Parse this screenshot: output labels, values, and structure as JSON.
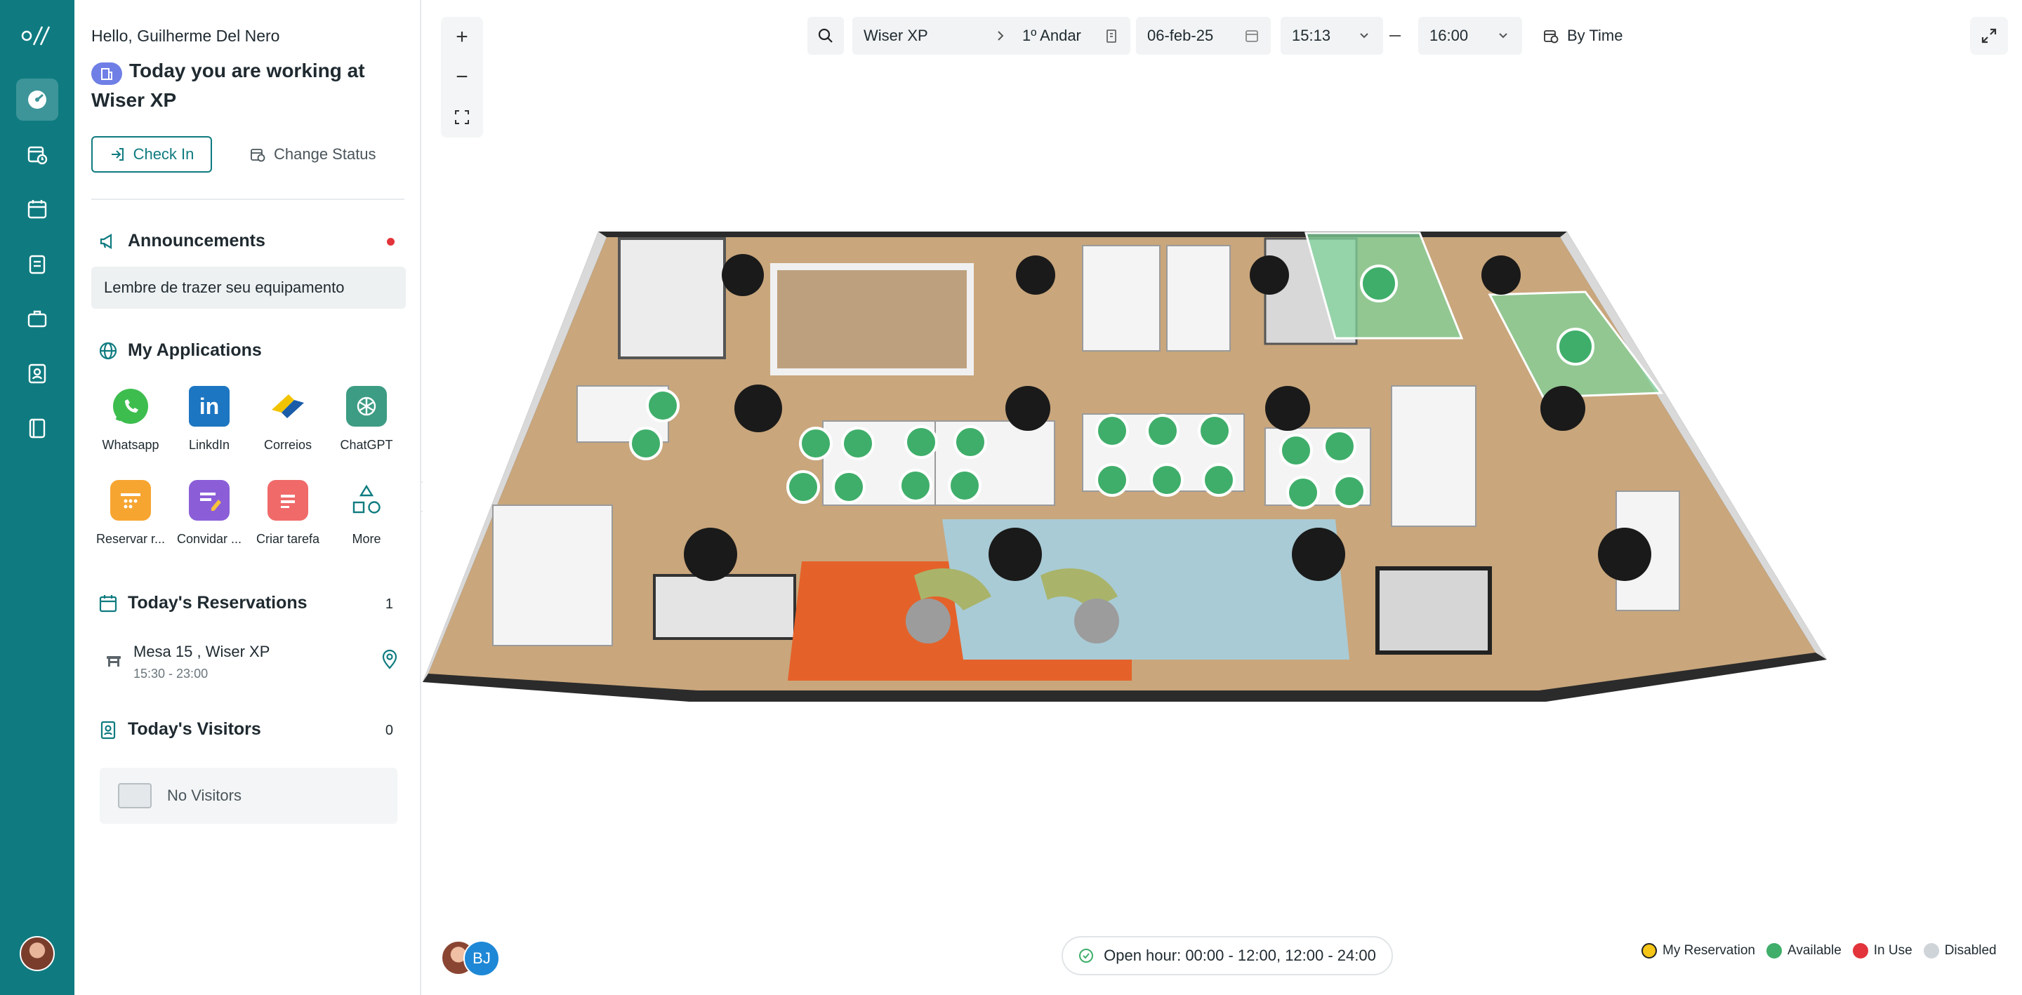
{
  "user": {
    "greeting": "Hello, Guilherme Del Nero",
    "working_at": "Today you are working at Wiser XP"
  },
  "actions": {
    "check_in": "Check In",
    "change_status": "Change Status"
  },
  "announcements": {
    "title": "Announcements",
    "items": [
      "Lembre de trazer seu equipamento"
    ]
  },
  "applications": {
    "title": "My Applications",
    "items": [
      {
        "label": "Whatsapp",
        "icon": "whatsapp-icon",
        "color": "#3dbd4e"
      },
      {
        "label": "LinkdIn",
        "icon": "linkedin-icon",
        "color": "#1d76c2"
      },
      {
        "label": "Correios",
        "icon": "correios-icon",
        "color": "#f2c400"
      },
      {
        "label": "ChatGPT",
        "icon": "chatgpt-icon",
        "color": "#3d9c84"
      },
      {
        "label": "Reservar r...",
        "icon": "calendar-app-icon",
        "color": "#f7a531"
      },
      {
        "label": "Convidar ...",
        "icon": "invite-app-icon",
        "color": "#8b5ed8"
      },
      {
        "label": "Criar tarefa",
        "icon": "task-app-icon",
        "color": "#f06a6a"
      },
      {
        "label": "More",
        "icon": "more-shapes-icon",
        "color": "#0f7b80"
      }
    ]
  },
  "reservations": {
    "title": "Today's Reservations",
    "count": "1",
    "items": [
      {
        "title": "Mesa 15 , Wiser XP",
        "time": "15:30 - 23:00"
      }
    ]
  },
  "visitors": {
    "title": "Today's Visitors",
    "count": "0",
    "empty_text": "No Visitors"
  },
  "filters": {
    "location": "Wiser XP",
    "floor": "1º Andar",
    "date": "06-feb-25",
    "start_time": "15:13",
    "end_time": "16:00",
    "mode": "By Time"
  },
  "zoom": {
    "in": "+",
    "out": "−"
  },
  "footer": {
    "open_hour": "Open hour: 00:00 - 12:00, 12:00 - 24:00",
    "avatar_initials": "BJ"
  },
  "legend": [
    {
      "label": "My Reservation",
      "color": "#f5c518"
    },
    {
      "label": "Available",
      "color": "#3fae6a"
    },
    {
      "label": "In Use",
      "color": "#e2343a"
    },
    {
      "label": "Disabled",
      "color": "#cfd4d8"
    }
  ],
  "colors": {
    "primary": "#0f7b80",
    "available": "#3fae6a"
  }
}
